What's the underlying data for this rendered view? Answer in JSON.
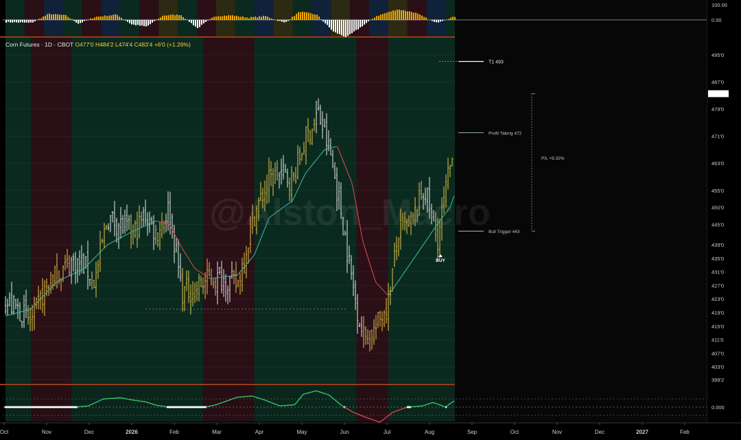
{
  "header": {
    "instrument": "Corn Futures · 1D · CBOT",
    "open": "O477'0",
    "high": "H484'2",
    "low": "L474'4",
    "close": "C483'4",
    "change": "+6'0 (+1.26%)"
  },
  "watermark": "@Alston_Macro",
  "colors": {
    "background": "#000000",
    "regime_green": "#0b2a1f",
    "regime_red": "#2a0f16",
    "regime_blue": "#10213a",
    "regime_olive": "#2c2a12",
    "bull_candle": "#e7c64a",
    "bear_candle": "#e9e9e9",
    "ma_up": "#3fb3a3",
    "ma_down": "#e0444e",
    "histogram_pos": "#f2a900",
    "histogram_neg": "#ffffff",
    "osc_up": "#39c66a",
    "osc_down": "#e0444e",
    "separator": "#c4531f"
  },
  "x_axis": {
    "labels": [
      "Oct",
      "Nov",
      "Dec",
      "2026",
      "Feb",
      "Mar",
      "Apr",
      "May",
      "Jun",
      "Jul",
      "Aug",
      "Sep",
      "Oct",
      "Nov",
      "Dec",
      "2027",
      "Feb"
    ],
    "bold": [
      "2026",
      "2027"
    ]
  },
  "top_panel": {
    "ticks": [
      "100.00",
      "0.00"
    ]
  },
  "bottom_panel": {
    "ticks": [
      "0.000"
    ]
  },
  "annotations": {
    "t1": "T1 493",
    "profit_taking": "Profit Taking 472",
    "bull_trigger": "Bull Trigger 443",
    "pl": "P/L +9.32%",
    "buy": "BUY"
  },
  "chart_data": {
    "type": "candlestick",
    "title": "Corn Futures · 1D · CBOT",
    "ylabel": "",
    "y_ticks": [
      "495'0",
      "487'0",
      "479'0",
      "471'0",
      "463'0",
      "455'0",
      "450'0",
      "445'0",
      "439'0",
      "435'0",
      "431'0",
      "427'0",
      "423'0",
      "419'0",
      "415'0",
      "411'0",
      "407'0",
      "403'0",
      "399'2"
    ],
    "ylim": [
      398,
      500
    ],
    "last_price": 483.5,
    "levels": {
      "t1": 493,
      "profit_taking": 472,
      "bull_trigger": 443
    },
    "regimes": [
      {
        "from": 0.0,
        "to": 0.6,
        "state": "bull"
      },
      {
        "from": 0.6,
        "to": 1.55,
        "state": "bear"
      },
      {
        "from": 1.55,
        "to": 4.65,
        "state": "bull"
      },
      {
        "from": 4.65,
        "to": 5.85,
        "state": "bear"
      },
      {
        "from": 5.85,
        "to": 8.25,
        "state": "bull"
      },
      {
        "from": 8.25,
        "to": 9.0,
        "state": "bear"
      },
      {
        "from": 9.0,
        "to": 10.65,
        "state": "bull"
      }
    ],
    "price_path": [
      [
        0.0,
        422
      ],
      [
        0.3,
        420
      ],
      [
        0.6,
        416
      ],
      [
        0.9,
        425
      ],
      [
        1.2,
        430
      ],
      [
        1.55,
        434
      ],
      [
        1.85,
        433
      ],
      [
        2.1,
        428
      ],
      [
        2.4,
        447
      ],
      [
        2.7,
        445
      ],
      [
        3.0,
        442
      ],
      [
        3.3,
        448
      ],
      [
        3.55,
        442
      ],
      [
        3.85,
        450
      ],
      [
        4.15,
        425
      ],
      [
        4.45,
        426
      ],
      [
        4.8,
        429
      ],
      [
        5.1,
        429
      ],
      [
        5.45,
        427
      ],
      [
        5.85,
        448
      ],
      [
        6.2,
        458
      ],
      [
        6.45,
        460
      ],
      [
        6.75,
        458
      ],
      [
        7.05,
        470
      ],
      [
        7.35,
        478
      ],
      [
        7.65,
        465
      ],
      [
        7.9,
        448
      ],
      [
        8.15,
        428
      ],
      [
        8.4,
        412
      ],
      [
        8.7,
        414
      ],
      [
        9.0,
        423
      ],
      [
        9.25,
        443
      ],
      [
        9.55,
        445
      ],
      [
        9.85,
        456
      ],
      [
        10.15,
        440
      ],
      [
        10.45,
        462
      ],
      [
        10.65,
        483
      ]
    ],
    "ma_path": [
      [
        0.0,
        418
      ],
      [
        0.6,
        420
      ],
      [
        1.2,
        428
      ],
      [
        1.85,
        432
      ],
      [
        2.4,
        439
      ],
      [
        3.0,
        443
      ],
      [
        3.55,
        446
      ],
      [
        3.85,
        445
      ],
      [
        4.15,
        438
      ],
      [
        4.45,
        432
      ],
      [
        4.8,
        429
      ],
      [
        5.45,
        430
      ],
      [
        5.85,
        436
      ],
      [
        6.2,
        447
      ],
      [
        6.75,
        452
      ],
      [
        7.05,
        460
      ],
      [
        7.5,
        467
      ],
      [
        7.8,
        468
      ],
      [
        8.15,
        457
      ],
      [
        8.4,
        440
      ],
      [
        8.7,
        428
      ],
      [
        9.0,
        424
      ],
      [
        9.55,
        434
      ],
      [
        10.15,
        445
      ],
      [
        10.45,
        450
      ],
      [
        10.65,
        457
      ]
    ],
    "oscillator_path": [
      [
        0.0,
        0
      ],
      [
        1.6,
        0
      ],
      [
        1.95,
        0.02
      ],
      [
        2.3,
        0.14
      ],
      [
        2.7,
        0.16
      ],
      [
        3.0,
        0.12
      ],
      [
        3.3,
        0.09
      ],
      [
        3.55,
        0.03
      ],
      [
        3.85,
        0
      ],
      [
        4.7,
        0
      ],
      [
        4.95,
        0.04
      ],
      [
        5.45,
        0.17
      ],
      [
        5.8,
        0.19
      ],
      [
        6.1,
        0.12
      ],
      [
        6.45,
        0.02
      ],
      [
        6.8,
        0.04
      ],
      [
        7.0,
        0.22
      ],
      [
        7.3,
        0.28
      ],
      [
        7.6,
        0.21
      ],
      [
        7.9,
        0.03
      ],
      [
        8.15,
        -0.08
      ],
      [
        8.45,
        -0.17
      ],
      [
        8.8,
        -0.26
      ],
      [
        9.1,
        -0.09
      ],
      [
        9.45,
        0.0
      ],
      [
        9.8,
        0.02
      ],
      [
        10.05,
        0.08
      ],
      [
        10.35,
        0
      ],
      [
        10.45,
        0.06
      ],
      [
        10.65,
        0.15
      ]
    ],
    "histogram_path": [
      [
        0.0,
        -6
      ],
      [
        0.6,
        -8
      ],
      [
        1.0,
        16
      ],
      [
        1.4,
        12
      ],
      [
        1.7,
        -10
      ],
      [
        2.1,
        8
      ],
      [
        2.6,
        14
      ],
      [
        2.95,
        -12
      ],
      [
        3.3,
        -18
      ],
      [
        3.7,
        12
      ],
      [
        4.1,
        14
      ],
      [
        4.5,
        -22
      ],
      [
        4.9,
        10
      ],
      [
        5.3,
        12
      ],
      [
        5.7,
        6
      ],
      [
        6.1,
        10
      ],
      [
        6.55,
        -8
      ],
      [
        6.9,
        22
      ],
      [
        7.3,
        14
      ],
      [
        7.7,
        -32
      ],
      [
        8.0,
        -46
      ],
      [
        8.3,
        -22
      ],
      [
        8.7,
        10
      ],
      [
        9.2,
        28
      ],
      [
        9.6,
        20
      ],
      [
        10.1,
        -8
      ],
      [
        10.4,
        4
      ],
      [
        10.65,
        12
      ]
    ]
  }
}
